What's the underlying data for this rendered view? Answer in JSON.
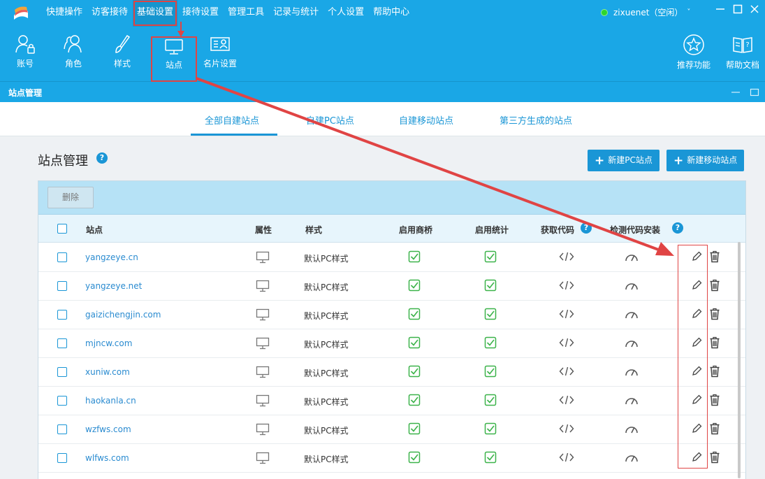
{
  "topbar": {
    "menu": [
      "快捷操作",
      "访客接待",
      "基础设置",
      "接待设置",
      "管理工具",
      "记录与统计",
      "个人设置",
      "帮助中心"
    ],
    "user_label": "zixuenet（空闲）",
    "user_caret": "˅"
  },
  "toolbar": {
    "account": "账号",
    "role": "角色",
    "style": "样式",
    "site": "站点",
    "card": "名片设置",
    "recommend": "推荐功能",
    "help_doc": "帮助文档"
  },
  "subbar": {
    "title": "站点管理"
  },
  "tabs": [
    "全部自建站点",
    "自建PC站点",
    "自建移动站点",
    "第三方生成的站点"
  ],
  "main": {
    "title": "站点管理",
    "help": "?",
    "new_pc": "新建PC站点",
    "new_mobile": "新建移动站点",
    "delete": "删除"
  },
  "table": {
    "headers": {
      "site": "站点",
      "attr": "属性",
      "style": "样式",
      "shangqiao": "启用商桥",
      "stats": "启用统计",
      "code": "获取代码",
      "detect": "检测代码安装"
    },
    "rows": [
      {
        "site": "yangzeye.cn",
        "style": "默认PC样式"
      },
      {
        "site": "yangzeye.net",
        "style": "默认PC样式"
      },
      {
        "site": "gaizichengjin.com",
        "style": "默认PC样式"
      },
      {
        "site": "mjncw.com",
        "style": "默认PC样式"
      },
      {
        "site": "xuniw.com",
        "style": "默认PC样式"
      },
      {
        "site": "haokanla.cn",
        "style": "默认PC样式"
      },
      {
        "site": "wzfws.com",
        "style": "默认PC样式"
      },
      {
        "site": "wlfws.com",
        "style": "默认PC样式"
      }
    ]
  },
  "colors": {
    "brand": "#1aa7e6",
    "accent": "#1a96d6",
    "check": "#3cb34a",
    "annotation": "#e04444"
  }
}
